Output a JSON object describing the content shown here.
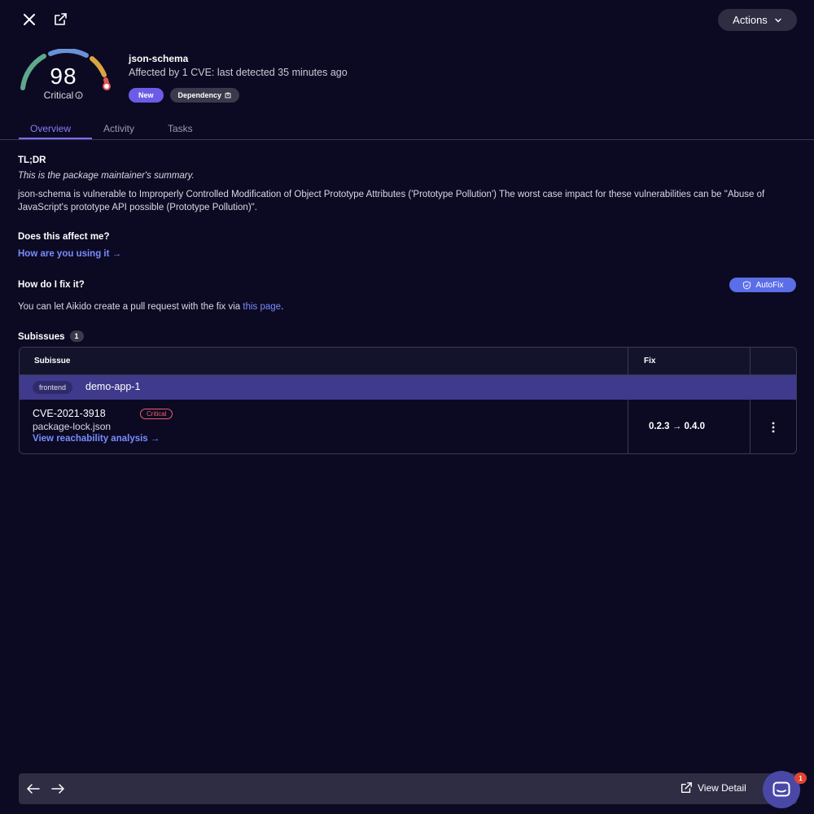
{
  "topbar": {
    "close_icon": "close-icon",
    "open_icon": "external-link-icon",
    "actions_label": "Actions"
  },
  "header": {
    "score": "98",
    "severity": "Critical",
    "package_name": "json-schema",
    "subtitle": "Affected by 1 CVE: last detected 35 minutes ago",
    "badge_new": "New",
    "badge_dependency": "Dependency"
  },
  "tabs": [
    {
      "label": "Overview",
      "active": true
    },
    {
      "label": "Activity",
      "active": false
    },
    {
      "label": "Tasks",
      "active": false
    }
  ],
  "overview": {
    "tldr_heading": "TL;DR",
    "tldr_summary": "This is the package maintainer's summary.",
    "tldr_body": "json-schema is vulnerable to Improperly Controlled Modification of Object Prototype Attributes ('Prototype Pollution') The worst case impact for these vulnerabilities can be \"Abuse of JavaScript's prototype API possible (Prototype Pollution)\".",
    "affect_heading": "Does this affect me?",
    "affect_link": "How are you using it →",
    "fix_heading": "How do I fix it?",
    "autofix_label": "AutoFix",
    "fix_text_before": "You can let Aikido create a pull request with the fix via ",
    "fix_link": "this page",
    "fix_text_after": ".",
    "subissues_heading": "Subissues",
    "subissues_count": "1"
  },
  "table": {
    "col_subissue": "Subissue",
    "col_fix": "Fix",
    "group": {
      "tag": "frontend",
      "name": "demo-app-1"
    },
    "rows": [
      {
        "cve": "CVE-2021-3918",
        "severity": "Critical",
        "file": "package-lock.json",
        "link": "View reachability analysis →",
        "fix": "0.2.3 → 0.4.0"
      }
    ]
  },
  "bottombar": {
    "view_detail": "View Detail",
    "chat_badge": "1"
  },
  "colors": {
    "background": "#0b0a22",
    "accent": "#7a6cf0",
    "link": "#7a8cff",
    "critical": "#f0606a"
  }
}
